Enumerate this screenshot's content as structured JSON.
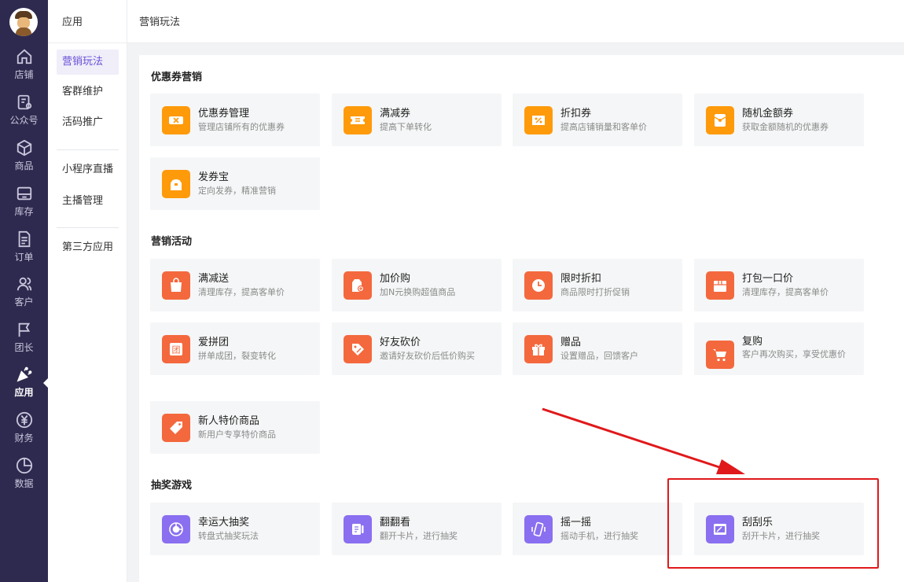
{
  "nav": {
    "items": [
      {
        "label": "店铺",
        "icon": "home-icon"
      },
      {
        "label": "公众号",
        "icon": "official-account-icon"
      },
      {
        "label": "商品",
        "icon": "box-icon"
      },
      {
        "label": "库存",
        "icon": "inventory-icon"
      },
      {
        "label": "订单",
        "icon": "order-icon"
      },
      {
        "label": "客户",
        "icon": "customer-icon"
      },
      {
        "label": "团长",
        "icon": "flag-icon"
      },
      {
        "label": "应用",
        "icon": "party-popper-icon"
      },
      {
        "label": "财务",
        "icon": "yuan-icon"
      },
      {
        "label": "数据",
        "icon": "pie-chart-icon"
      }
    ],
    "active_index": 7
  },
  "submenu": {
    "title": "应用",
    "items": [
      "营销玩法",
      "客群维护",
      "活码推广",
      "小程序直播",
      "主播管理",
      "第三方应用"
    ],
    "active": "营销玩法"
  },
  "header": {
    "breadcrumb": "营销玩法"
  },
  "sections": [
    {
      "title": "优惠券营销",
      "cards": [
        {
          "title": "优惠券管理",
          "desc": "管理店铺所有的优惠券",
          "icon": "coupon-icon",
          "color": "#ff9a0a"
        },
        {
          "title": "满减券",
          "desc": "提高下单转化",
          "icon": "ticket-icon",
          "color": "#ff9a0a"
        },
        {
          "title": "折扣券",
          "desc": "提高店铺销量和客单价",
          "icon": "percent-tag-icon",
          "color": "#ff9a0a"
        },
        {
          "title": "随机金额券",
          "desc": "获取金额随机的优惠券",
          "icon": "red-envelope-icon",
          "color": "#ff9a0a"
        },
        {
          "title": "发券宝",
          "desc": "定向发券，精准营销",
          "icon": "treasure-box-icon",
          "color": "#ff9a0a"
        }
      ]
    },
    {
      "title": "营销活动",
      "cards": [
        {
          "title": "满减送",
          "desc": "清理库存，提高客单价",
          "icon": "shopping-bag-icon",
          "color": "#f4683d"
        },
        {
          "title": "加价购",
          "desc": "加N元换购超值商品",
          "icon": "price-tag-plus-icon",
          "color": "#f4683d"
        },
        {
          "title": "限时折扣",
          "desc": "商品限时打折促销",
          "icon": "clock-icon",
          "color": "#f4683d"
        },
        {
          "title": "打包一口价",
          "desc": "清理库存，提高客单价",
          "icon": "package-icon",
          "color": "#f4683d"
        },
        {
          "title": "爱拼团",
          "desc": "拼单成团，裂变转化",
          "icon": "group-buy-icon",
          "color": "#f4683d"
        },
        {
          "title": "好友砍价",
          "desc": "邀请好友砍价后低价购买",
          "icon": "bargain-icon",
          "color": "#f4683d"
        },
        {
          "title": "赠品",
          "desc": "设置赠品，回馈客户",
          "icon": "gift-icon",
          "color": "#f4683d"
        },
        {
          "title": "复购",
          "desc": "客户再次购买，享受优惠价",
          "icon": "cart-icon",
          "color": "#f4683d"
        },
        {
          "title": "新人特价商品",
          "desc": "新用户专享特价商品",
          "icon": "new-user-tag-icon",
          "color": "#f4683d"
        }
      ]
    },
    {
      "title": "抽奖游戏",
      "cards": [
        {
          "title": "幸运大抽奖",
          "desc": "转盘式抽奖玩法",
          "icon": "lucky-wheel-icon",
          "color": "#8a6ff0"
        },
        {
          "title": "翻翻看",
          "desc": "翻开卡片，进行抽奖",
          "icon": "flip-card-icon",
          "color": "#8a6ff0"
        },
        {
          "title": "摇一摇",
          "desc": "摇动手机，进行抽奖",
          "icon": "shake-phone-icon",
          "color": "#8a6ff0"
        },
        {
          "title": "刮刮乐",
          "desc": "刮开卡片，进行抽奖",
          "icon": "scratch-card-icon",
          "color": "#8a6ff0"
        }
      ]
    }
  ],
  "annotation": {
    "highlight_color": "#e0191b"
  }
}
